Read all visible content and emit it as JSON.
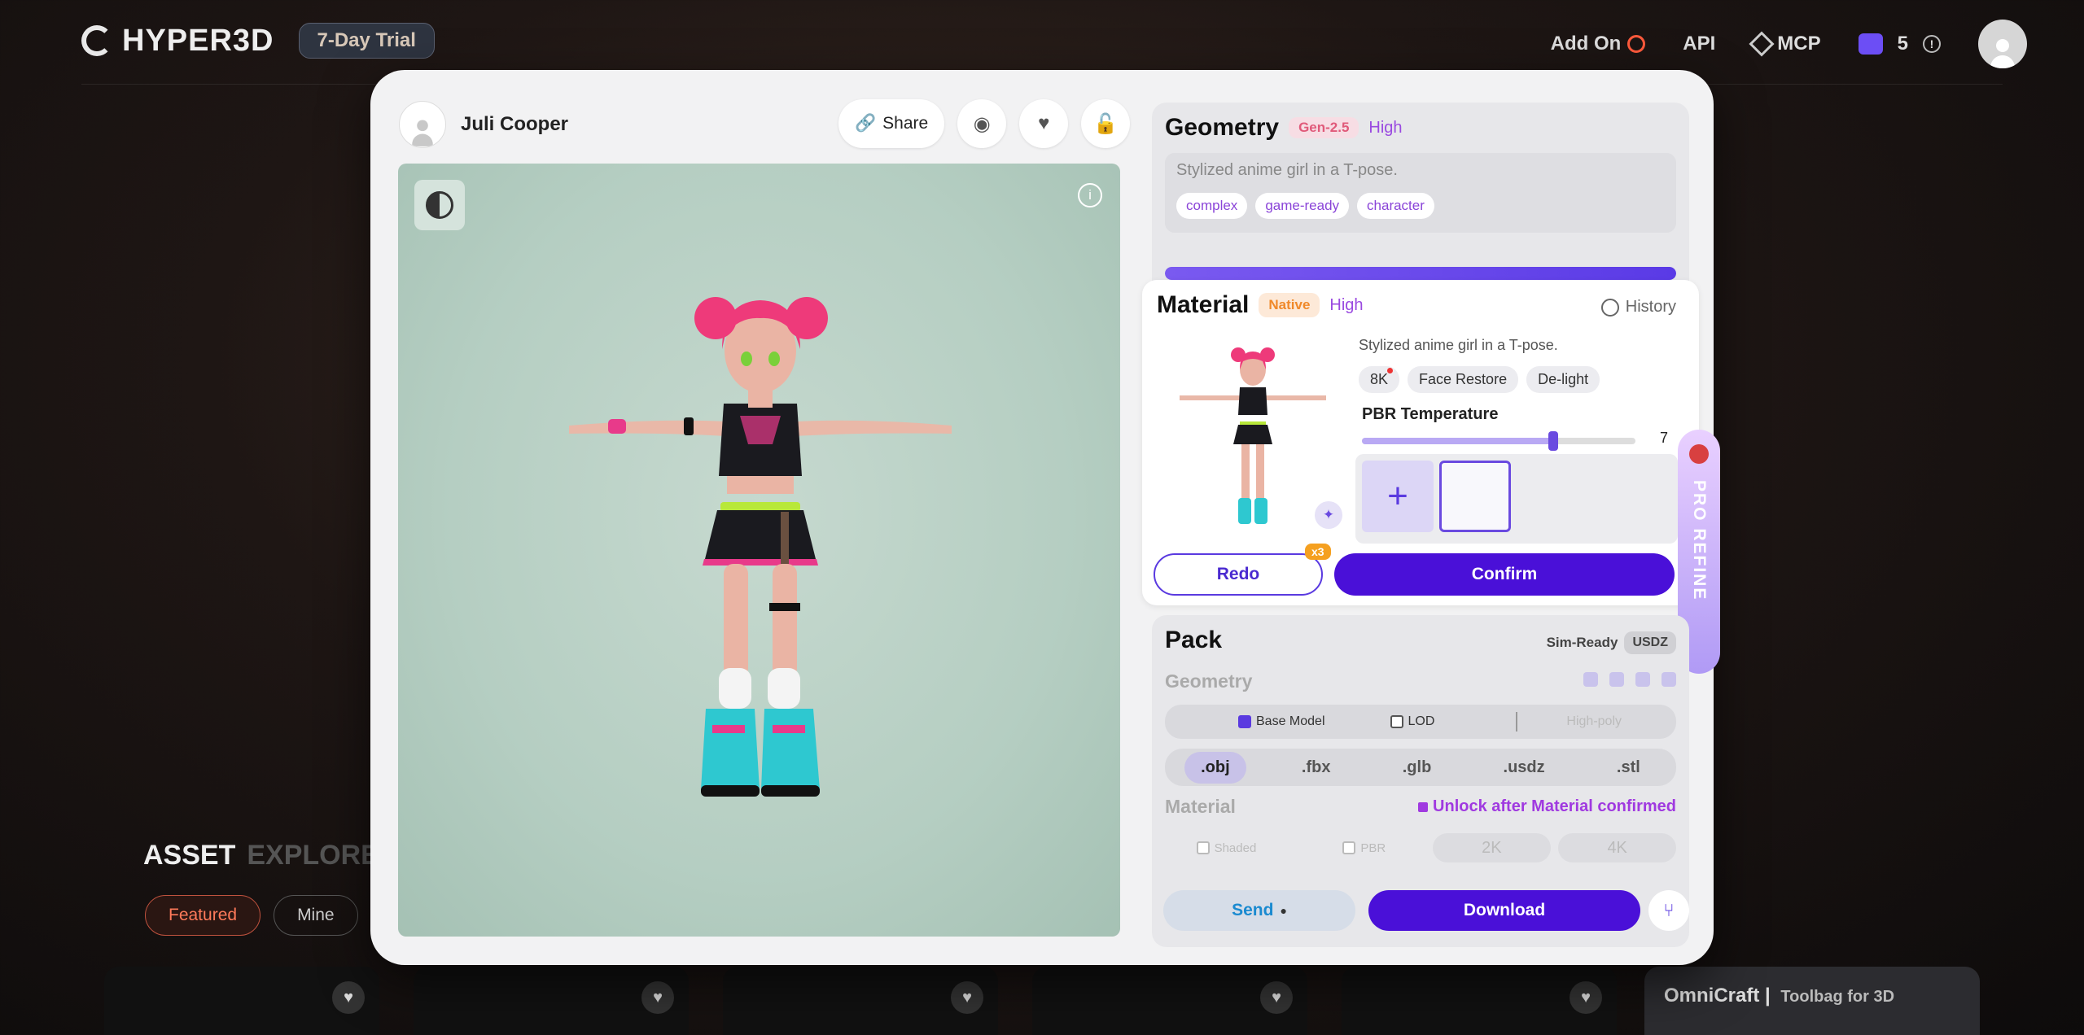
{
  "topbar": {
    "brand": "HYPER3D",
    "trial_badge": "7-Day Trial",
    "nav": {
      "addon": "Add On",
      "api": "API",
      "mcp": "MCP",
      "credits": "5",
      "credits_info": "!"
    }
  },
  "explorer": {
    "title_a": "ASSET",
    "title_b": "EXPLORE",
    "filters": [
      "Featured",
      "Mine"
    ],
    "heart_glyph": "♥",
    "omnicraft": {
      "title": "OmniCraft",
      "subtitle": "Toolbag for 3D"
    }
  },
  "modal": {
    "author": "Juli Cooper",
    "share_label": "Share",
    "viewer_info": "i",
    "geometry": {
      "title": "Geometry",
      "version": "Gen-2.5",
      "quality": "High",
      "prompt": "Stylized anime girl in a T-pose.",
      "tags": [
        "complex",
        "game-ready",
        "character"
      ],
      "progress": 1.0
    },
    "material": {
      "title": "Material",
      "mode": "Native",
      "quality": "High",
      "history": "History",
      "prompt": "Stylized anime girl in a T-pose.",
      "options": [
        "8K",
        "Face Restore",
        "De-light"
      ],
      "pbr_label": "PBR Temperature",
      "pbr_value": "7",
      "pbr_fraction": 0.7,
      "add_glyph": "+",
      "redo": "Redo",
      "redo_multiplier": "x3",
      "confirm": "Confirm"
    },
    "pro_refine": "PRO REFINE",
    "pack": {
      "title": "Pack",
      "sim_ready": "Sim-Ready",
      "usdz": "USDZ",
      "geometry_label": "Geometry",
      "base_model": "Base Model",
      "lod": "LOD",
      "high_poly": "High-poly",
      "formats": [
        ".obj",
        ".fbx",
        ".glb",
        ".usdz",
        ".stl"
      ],
      "material_label": "Material",
      "unlock_text": "Unlock after Material confirmed",
      "shaded": "Shaded",
      "pbr": "PBR",
      "res_2k": "2K",
      "res_4k": "4K",
      "send": "Send",
      "download": "Download"
    }
  },
  "colors": {
    "accent": "#4a10d8",
    "accent_light": "#6a4ae0",
    "brand_orange": "#ff5a3c"
  }
}
